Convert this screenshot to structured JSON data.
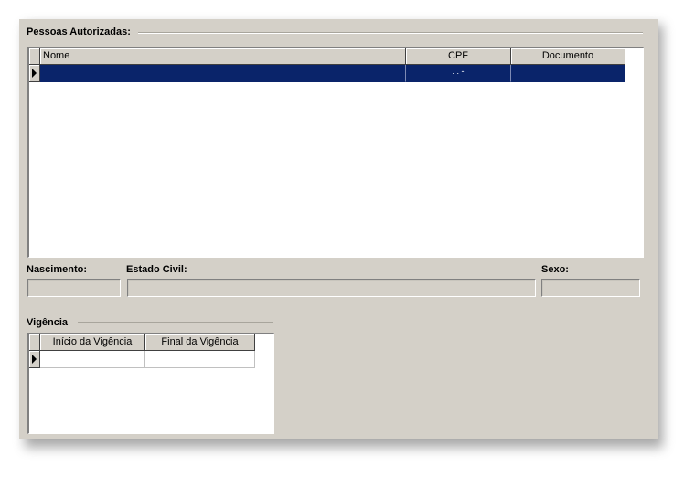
{
  "authorized_group": {
    "title": "Pessoas Autorizadas:",
    "columns": [
      "Nome",
      "CPF",
      "Documento"
    ],
    "rows": [
      {
        "nome": "",
        "cpf": ". . -",
        "documento": ""
      }
    ],
    "selection_color": "#0a246a"
  },
  "details": {
    "nascimento_label": "Nascimento:",
    "nascimento_value": "",
    "estado_civil_label": "Estado Civil:",
    "estado_civil_value": "",
    "sexo_label": "Sexo:",
    "sexo_value": ""
  },
  "vigencia_group": {
    "title": "Vigência",
    "columns": [
      "Início da Vigência",
      "Final da Vigência"
    ],
    "rows": [
      {
        "inicio": "",
        "final": ""
      }
    ]
  }
}
